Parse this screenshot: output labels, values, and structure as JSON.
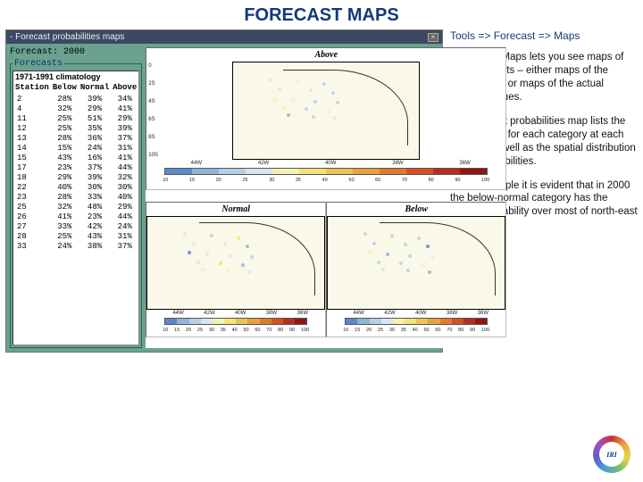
{
  "title": "FORECAST MAPS",
  "breadcrumb": "Tools => Forecast => Maps",
  "paragraphs": [
    "The option Maps lets you see maps of your forecasts – either maps of the probabilities or maps of the actual forecast values.",
    "The forecast probabilities map lists the probabilities for each category at each location as well as the spatial distribution of the probabilities.",
    "In this example it is evident that in 2000 the below-normal category has the lowest probability over most of north-east Brazil."
  ],
  "window": {
    "titlebar": "- Forecast probabilities maps",
    "forecast_label": "Forecast: 2000",
    "fieldset_legend": "Forecasts",
    "climatology_line": "1971-1991 climatology",
    "headers": [
      "Station",
      "Below",
      "Normal",
      "Above"
    ],
    "rows": [
      [
        "2",
        "28%",
        "39%",
        "34%"
      ],
      [
        "4",
        "32%",
        "29%",
        "41%"
      ],
      [
        "11",
        "25%",
        "51%",
        "29%"
      ],
      [
        "12",
        "25%",
        "35%",
        "39%"
      ],
      [
        "13",
        "28%",
        "36%",
        "37%"
      ],
      [
        "14",
        "15%",
        "24%",
        "31%"
      ],
      [
        "15",
        "43%",
        "16%",
        "41%"
      ],
      [
        "17",
        "23%",
        "37%",
        "44%"
      ],
      [
        "18",
        "29%",
        "39%",
        "32%"
      ],
      [
        "22",
        "40%",
        "30%",
        "30%"
      ],
      [
        "23",
        "28%",
        "33%",
        "40%"
      ],
      [
        "25",
        "32%",
        "48%",
        "29%"
      ],
      [
        "26",
        "41%",
        "23%",
        "44%"
      ],
      [
        "27",
        "33%",
        "42%",
        "24%"
      ],
      [
        "28",
        "25%",
        "43%",
        "31%"
      ],
      [
        "33",
        "24%",
        "38%",
        "37%"
      ]
    ]
  },
  "maps": {
    "top_title": "Above",
    "bottom_left_title": "Normal",
    "bottom_right_title": "Below",
    "y_ticks": [
      "0",
      "2S",
      "4S",
      "6S",
      "8S",
      "10S"
    ],
    "x_ticks": [
      "44W",
      "42W",
      "40W",
      "38W",
      "36W"
    ],
    "cb_labels": [
      "10",
      "15",
      "20",
      "25",
      "30",
      "35",
      "40",
      "50",
      "60",
      "70",
      "80",
      "90",
      "100"
    ],
    "cb_colors": [
      "#5a88c8",
      "#8fb4da",
      "#b6d0e6",
      "#d8e6ef",
      "#f4f2b0",
      "#f5e27a",
      "#f0c452",
      "#eaa13c",
      "#e07a2e",
      "#d74f25",
      "#b82c1e",
      "#8e1716"
    ]
  },
  "logo": "IRI",
  "chart_data": {
    "type": "table",
    "title": "Forecast: 2000 — 1971-1991 climatology",
    "columns": [
      "Station",
      "Below",
      "Normal",
      "Above"
    ],
    "rows": [
      {
        "Station": 2,
        "Below": 28,
        "Normal": 39,
        "Above": 34
      },
      {
        "Station": 4,
        "Below": 32,
        "Normal": 29,
        "Above": 41
      },
      {
        "Station": 11,
        "Below": 25,
        "Normal": 51,
        "Above": 29
      },
      {
        "Station": 12,
        "Below": 25,
        "Normal": 35,
        "Above": 39
      },
      {
        "Station": 13,
        "Below": 28,
        "Normal": 36,
        "Above": 37
      },
      {
        "Station": 14,
        "Below": 15,
        "Normal": 24,
        "Above": 31
      },
      {
        "Station": 15,
        "Below": 43,
        "Normal": 16,
        "Above": 41
      },
      {
        "Station": 17,
        "Below": 23,
        "Normal": 37,
        "Above": 44
      },
      {
        "Station": 18,
        "Below": 29,
        "Normal": 39,
        "Above": 32
      },
      {
        "Station": 22,
        "Below": 40,
        "Normal": 30,
        "Above": 30
      },
      {
        "Station": 23,
        "Below": 28,
        "Normal": 33,
        "Above": 40
      },
      {
        "Station": 25,
        "Below": 32,
        "Normal": 48,
        "Above": 29
      },
      {
        "Station": 26,
        "Below": 41,
        "Normal": 23,
        "Above": 44
      },
      {
        "Station": 27,
        "Below": 33,
        "Normal": 42,
        "Above": 24
      },
      {
        "Station": 28,
        "Below": 25,
        "Normal": 43,
        "Above": 31
      },
      {
        "Station": 33,
        "Below": 24,
        "Normal": 38,
        "Above": 37
      }
    ],
    "unit": "percent"
  }
}
